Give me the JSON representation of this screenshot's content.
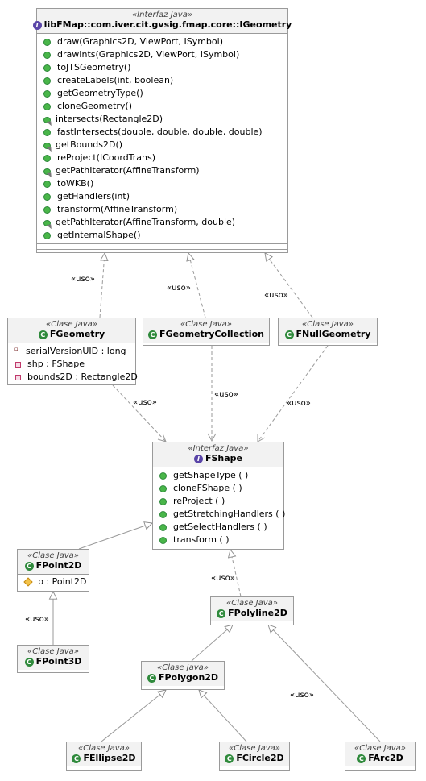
{
  "colors": {
    "line": "#9a9a9a",
    "header_bg": "#f2f2f2",
    "class_icon": "#2f8a3c",
    "interface_icon": "#5a45a8",
    "public_method": "#49b649"
  },
  "stereotypes": {
    "interface": "«Interfaz Java»",
    "class": "«Clase Java»"
  },
  "uso_label": "«uso»",
  "igeometry": {
    "name": "libFMap::com.iver.cit.gvsig.fmap.core::IGeometry",
    "icon": "I",
    "methods": [
      {
        "label": "draw(Graphics2D, ViewPort, ISymbol)",
        "icon": "public-method-icon"
      },
      {
        "label": "drawInts(Graphics2D, ViewPort, ISymbol)",
        "icon": "public-method-icon"
      },
      {
        "label": "toJTSGeometry()",
        "icon": "public-method-icon"
      },
      {
        "label": "createLabels(int, boolean)",
        "icon": "public-method-icon"
      },
      {
        "label": "getGeometryType()",
        "icon": "public-method-icon"
      },
      {
        "label": "cloneGeometry()",
        "icon": "public-method-icon"
      },
      {
        "label": "intersects(Rectangle2D)",
        "icon": "abstract-method-icon"
      },
      {
        "label": "fastIntersects(double, double, double, double)",
        "icon": "public-method-icon"
      },
      {
        "label": "getBounds2D()",
        "icon": "abstract-method-icon"
      },
      {
        "label": "reProject(ICoordTrans)",
        "icon": "public-method-icon"
      },
      {
        "label": "getPathIterator(AffineTransform)",
        "icon": "abstract-method-icon"
      },
      {
        "label": "toWKB()",
        "icon": "public-method-icon"
      },
      {
        "label": "getHandlers(int)",
        "icon": "public-method-icon"
      },
      {
        "label": "transform(AffineTransform)",
        "icon": "public-method-icon"
      },
      {
        "label": "getPathIterator(AffineTransform, double)",
        "icon": "abstract-method-icon"
      },
      {
        "label": "getInternalShape()",
        "icon": "public-method-icon"
      }
    ]
  },
  "fgeometry": {
    "name": "FGeometry",
    "icon": "C",
    "fields": [
      {
        "label": "serialVersionUID : long",
        "icon": "static-field-icon"
      },
      {
        "label": "shp : FShape",
        "icon": "private-field-icon"
      },
      {
        "label": "bounds2D : Rectangle2D",
        "icon": "private-field-icon"
      }
    ]
  },
  "fgeometrycollection": {
    "name": "FGeometryCollection",
    "icon": "C"
  },
  "fnullgeometry": {
    "name": "FNullGeometry",
    "icon": "C"
  },
  "fshape": {
    "name": "FShape",
    "icon": "I",
    "methods": [
      {
        "label": "getShapeType ( )",
        "icon": "public-method-icon"
      },
      {
        "label": "cloneFShape ( )",
        "icon": "public-method-icon"
      },
      {
        "label": "reProject ( )",
        "icon": "public-method-icon"
      },
      {
        "label": "getStretchingHandlers ( )",
        "icon": "public-method-icon"
      },
      {
        "label": "getSelectHandlers ( )",
        "icon": "public-method-icon"
      },
      {
        "label": "transform ( )",
        "icon": "public-method-icon"
      }
    ]
  },
  "fpoint2d": {
    "name": "FPoint2D",
    "icon": "C",
    "fields": [
      {
        "label": "p : Point2D",
        "icon": "protected-field-icon"
      }
    ]
  },
  "fpoint3d": {
    "name": "FPoint3D",
    "icon": "C"
  },
  "fpolyline2d": {
    "name": "FPolyline2D",
    "icon": "C"
  },
  "fpolygon2d": {
    "name": "FPolygon2D",
    "icon": "C"
  },
  "fellipse2d": {
    "name": "FEllipse2D",
    "icon": "C"
  },
  "fcircle2d": {
    "name": "FCircle2D",
    "icon": "C"
  },
  "farc2d": {
    "name": "FArc2D",
    "icon": "C"
  }
}
